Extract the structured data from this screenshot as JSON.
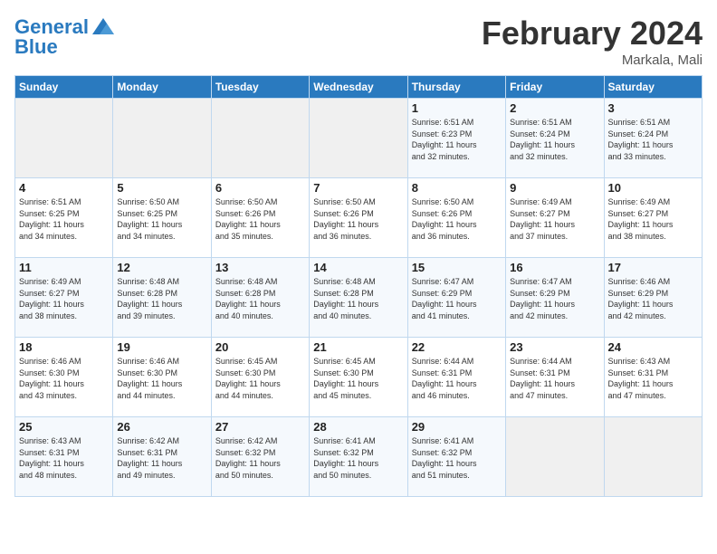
{
  "header": {
    "logo_line1": "General",
    "logo_line2": "Blue",
    "month": "February 2024",
    "location": "Markala, Mali"
  },
  "days_of_week": [
    "Sunday",
    "Monday",
    "Tuesday",
    "Wednesday",
    "Thursday",
    "Friday",
    "Saturday"
  ],
  "weeks": [
    [
      {
        "day": "",
        "info": ""
      },
      {
        "day": "",
        "info": ""
      },
      {
        "day": "",
        "info": ""
      },
      {
        "day": "",
        "info": ""
      },
      {
        "day": "1",
        "info": "Sunrise: 6:51 AM\nSunset: 6:23 PM\nDaylight: 11 hours\nand 32 minutes."
      },
      {
        "day": "2",
        "info": "Sunrise: 6:51 AM\nSunset: 6:24 PM\nDaylight: 11 hours\nand 32 minutes."
      },
      {
        "day": "3",
        "info": "Sunrise: 6:51 AM\nSunset: 6:24 PM\nDaylight: 11 hours\nand 33 minutes."
      }
    ],
    [
      {
        "day": "4",
        "info": "Sunrise: 6:51 AM\nSunset: 6:25 PM\nDaylight: 11 hours\nand 34 minutes."
      },
      {
        "day": "5",
        "info": "Sunrise: 6:50 AM\nSunset: 6:25 PM\nDaylight: 11 hours\nand 34 minutes."
      },
      {
        "day": "6",
        "info": "Sunrise: 6:50 AM\nSunset: 6:26 PM\nDaylight: 11 hours\nand 35 minutes."
      },
      {
        "day": "7",
        "info": "Sunrise: 6:50 AM\nSunset: 6:26 PM\nDaylight: 11 hours\nand 36 minutes."
      },
      {
        "day": "8",
        "info": "Sunrise: 6:50 AM\nSunset: 6:26 PM\nDaylight: 11 hours\nand 36 minutes."
      },
      {
        "day": "9",
        "info": "Sunrise: 6:49 AM\nSunset: 6:27 PM\nDaylight: 11 hours\nand 37 minutes."
      },
      {
        "day": "10",
        "info": "Sunrise: 6:49 AM\nSunset: 6:27 PM\nDaylight: 11 hours\nand 38 minutes."
      }
    ],
    [
      {
        "day": "11",
        "info": "Sunrise: 6:49 AM\nSunset: 6:27 PM\nDaylight: 11 hours\nand 38 minutes."
      },
      {
        "day": "12",
        "info": "Sunrise: 6:48 AM\nSunset: 6:28 PM\nDaylight: 11 hours\nand 39 minutes."
      },
      {
        "day": "13",
        "info": "Sunrise: 6:48 AM\nSunset: 6:28 PM\nDaylight: 11 hours\nand 40 minutes."
      },
      {
        "day": "14",
        "info": "Sunrise: 6:48 AM\nSunset: 6:28 PM\nDaylight: 11 hours\nand 40 minutes."
      },
      {
        "day": "15",
        "info": "Sunrise: 6:47 AM\nSunset: 6:29 PM\nDaylight: 11 hours\nand 41 minutes."
      },
      {
        "day": "16",
        "info": "Sunrise: 6:47 AM\nSunset: 6:29 PM\nDaylight: 11 hours\nand 42 minutes."
      },
      {
        "day": "17",
        "info": "Sunrise: 6:46 AM\nSunset: 6:29 PM\nDaylight: 11 hours\nand 42 minutes."
      }
    ],
    [
      {
        "day": "18",
        "info": "Sunrise: 6:46 AM\nSunset: 6:30 PM\nDaylight: 11 hours\nand 43 minutes."
      },
      {
        "day": "19",
        "info": "Sunrise: 6:46 AM\nSunset: 6:30 PM\nDaylight: 11 hours\nand 44 minutes."
      },
      {
        "day": "20",
        "info": "Sunrise: 6:45 AM\nSunset: 6:30 PM\nDaylight: 11 hours\nand 44 minutes."
      },
      {
        "day": "21",
        "info": "Sunrise: 6:45 AM\nSunset: 6:30 PM\nDaylight: 11 hours\nand 45 minutes."
      },
      {
        "day": "22",
        "info": "Sunrise: 6:44 AM\nSunset: 6:31 PM\nDaylight: 11 hours\nand 46 minutes."
      },
      {
        "day": "23",
        "info": "Sunrise: 6:44 AM\nSunset: 6:31 PM\nDaylight: 11 hours\nand 47 minutes."
      },
      {
        "day": "24",
        "info": "Sunrise: 6:43 AM\nSunset: 6:31 PM\nDaylight: 11 hours\nand 47 minutes."
      }
    ],
    [
      {
        "day": "25",
        "info": "Sunrise: 6:43 AM\nSunset: 6:31 PM\nDaylight: 11 hours\nand 48 minutes."
      },
      {
        "day": "26",
        "info": "Sunrise: 6:42 AM\nSunset: 6:31 PM\nDaylight: 11 hours\nand 49 minutes."
      },
      {
        "day": "27",
        "info": "Sunrise: 6:42 AM\nSunset: 6:32 PM\nDaylight: 11 hours\nand 50 minutes."
      },
      {
        "day": "28",
        "info": "Sunrise: 6:41 AM\nSunset: 6:32 PM\nDaylight: 11 hours\nand 50 minutes."
      },
      {
        "day": "29",
        "info": "Sunrise: 6:41 AM\nSunset: 6:32 PM\nDaylight: 11 hours\nand 51 minutes."
      },
      {
        "day": "",
        "info": ""
      },
      {
        "day": "",
        "info": ""
      }
    ]
  ]
}
